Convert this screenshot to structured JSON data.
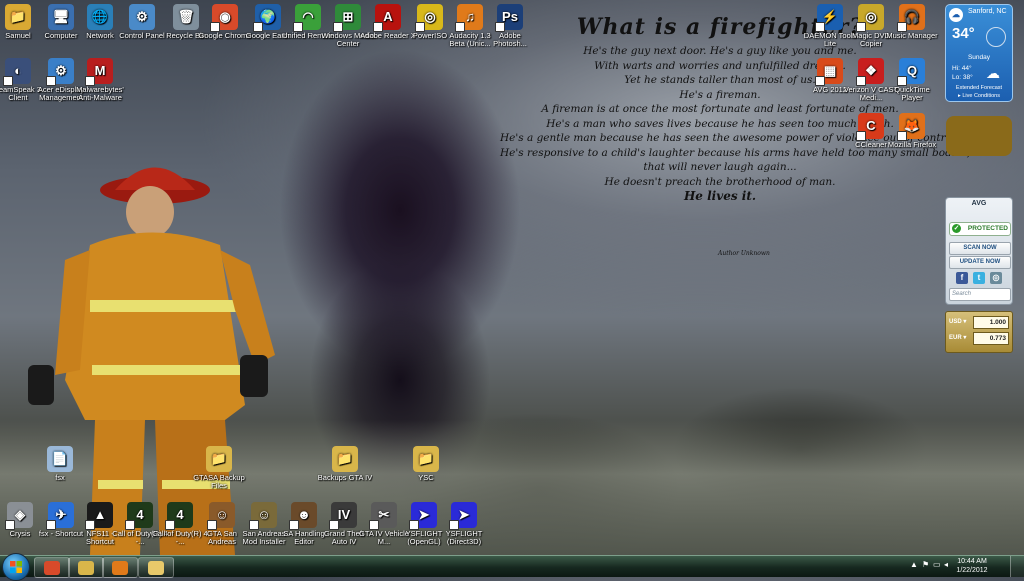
{
  "poem": {
    "title": "What is a firefighter?",
    "lines": [
      "He's the guy next door. He's a guy like you and me.",
      "With warts and worries and unfulfilled dreams.",
      "Yet he stands taller than most of us.",
      "He's a fireman.",
      "A fireman is at once the most fortunate and least fortunate of men.",
      "He's a man who saves lives because he has seen too much death.",
      "He's a gentle man because he has seen the awesome power of violence out of control.",
      "He's responsive to a child's laughter because his arms have held too many small bodies,",
      "that will never laugh again...",
      "He doesn't preach the brotherhood of man.",
      "He lives it."
    ],
    "author": "Author Unknown"
  },
  "icons_top": [
    {
      "label": "Samuel",
      "glyph": "📁",
      "color": "#d9a933"
    },
    {
      "label": "Computer",
      "glyph": "🖥",
      "color": "#3a6fb0"
    },
    {
      "label": "Network",
      "glyph": "🌐",
      "color": "#2a7fb8"
    },
    {
      "label": "Control Panel",
      "glyph": "⚙",
      "color": "#4a8ac8"
    },
    {
      "label": "Recycle Bin",
      "glyph": "🗑",
      "color": "#7f8f9c"
    },
    {
      "label": "Google Chrome",
      "glyph": "◉",
      "color": "#d84a2a"
    },
    {
      "label": "Google Earth",
      "glyph": "🌍",
      "color": "#1f5fa8"
    },
    {
      "label": "Unified Remote",
      "glyph": "◠",
      "color": "#3aa03a"
    },
    {
      "label": "Windows Media Center",
      "glyph": "⊞",
      "color": "#2f8a3a"
    },
    {
      "label": "Adobe Reader X",
      "glyph": "A",
      "color": "#b8120e"
    },
    {
      "label": "PowerISO",
      "glyph": "◎",
      "color": "#d8b81a"
    },
    {
      "label": "Audacity 1.3 Beta (Unic...",
      "glyph": "♫",
      "color": "#e07a1a"
    },
    {
      "label": "Adobe Photosh...",
      "glyph": "Ps",
      "color": "#1c3f78"
    }
  ],
  "icons_row2": [
    {
      "label": "TeamSpeak 3 Client",
      "glyph": "◐",
      "color": "#3a4f7a"
    },
    {
      "label": "Acer eDisplay Management",
      "glyph": "⚙",
      "color": "#3a7fc8"
    },
    {
      "label": "Malwarebytes' Anti-Malware",
      "glyph": "M",
      "color": "#b81e1e"
    }
  ],
  "icons_right": [
    {
      "label": "DAEMON Tools Lite",
      "glyph": "⚡",
      "color": "#1a5fb0"
    },
    {
      "label": "Magic DVD Copier",
      "glyph": "◎",
      "color": "#c8a82a"
    },
    {
      "label": "Music Manager",
      "glyph": "🎧",
      "color": "#e0701a"
    },
    {
      "label": "AVG 2012",
      "glyph": "▦",
      "color": "#d84a1a"
    },
    {
      "label": "Verizon V CAST Medi...",
      "glyph": "❖",
      "color": "#c81e1e"
    },
    {
      "label": "QuickTime Player",
      "glyph": "Q",
      "color": "#2a7fd8"
    },
    {
      "label": "CCleaner",
      "glyph": "C",
      "color": "#d83a1a"
    },
    {
      "label": "Mozilla Firefox",
      "glyph": "🦊",
      "color": "#e0701a"
    }
  ],
  "icons_middle": [
    {
      "label": "fsx",
      "glyph": "📄",
      "color": "#9ab8d8"
    },
    {
      "label": "GTASA Backup Files",
      "glyph": "📁",
      "color": "#d9b64a"
    },
    {
      "label": "Backups GTA IV",
      "glyph": "📁",
      "color": "#d9b64a"
    },
    {
      "label": "YSC",
      "glyph": "📁",
      "color": "#d9b64a"
    }
  ],
  "icons_bottom": [
    {
      "label": "Crysis",
      "glyph": "◈",
      "color": "#8a8f95"
    },
    {
      "label": "fsx - Shortcut",
      "glyph": "✈",
      "color": "#2a6fd8"
    },
    {
      "label": "NFS11 - Shortcut",
      "glyph": "▲",
      "color": "#1a1a1a"
    },
    {
      "label": "Call of Duty(R) 4 -...",
      "glyph": "4",
      "color": "#1f3a1a"
    },
    {
      "label": "Call of Duty(R) 4 -...",
      "glyph": "4",
      "color": "#1f3a1a"
    },
    {
      "label": "GTA San Andreas",
      "glyph": "☺",
      "color": "#8a5a2a"
    },
    {
      "label": "San Andreas Mod Installer",
      "glyph": "☺",
      "color": "#7a6a3a"
    },
    {
      "label": "SA Handling Editor",
      "glyph": "☻",
      "color": "#6a4a2a"
    },
    {
      "label": "Grand Theft Auto IV",
      "glyph": "IV",
      "color": "#3a3a3a"
    },
    {
      "label": "GTA IV Vehicle M...",
      "glyph": "✂",
      "color": "#5a5a5a"
    },
    {
      "label": "YSFLIGHT (OpenGL)",
      "glyph": "➤",
      "color": "#2a2ad8"
    },
    {
      "label": "YSFLIGHT (Direct3D)",
      "glyph": "➤",
      "color": "#2a2ad8"
    }
  ],
  "weather": {
    "city": "Sanford, NC",
    "temp": "34°",
    "day": "Sunday",
    "hi": "Hi: 44°",
    "lo": "Lo: 38°",
    "extended": "Extended Forecast",
    "live": "▸ Live Conditions"
  },
  "avg": {
    "title": "AVG",
    "status": "PROTECTED",
    "scan": "SCAN NOW",
    "update": "UPDATE NOW",
    "search_placeholder": "Search"
  },
  "currency": {
    "from_code": "USD ▾",
    "from_value": "1.000",
    "to_code": "EUR ▾",
    "to_value": "0.773"
  },
  "taskbar": {
    "time": "10:44 AM",
    "date": "1/22/2012",
    "tray_arrow": "▲",
    "pinned": [
      {
        "name": "chrome",
        "color": "#d84a2a"
      },
      {
        "name": "explorer",
        "color": "#d9b64a"
      },
      {
        "name": "media-player",
        "color": "#e07a1a"
      },
      {
        "name": "folder",
        "color": "#e8c96a"
      }
    ]
  }
}
